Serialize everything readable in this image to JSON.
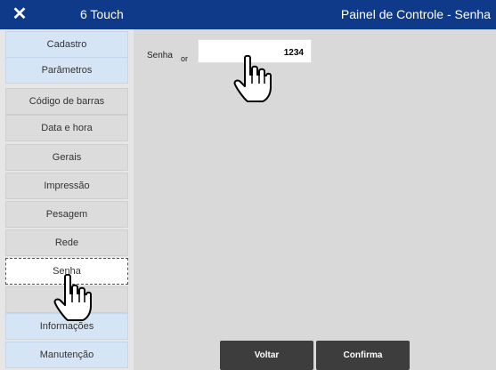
{
  "titlebar": {
    "app_name": "6 Touch",
    "context_title": "Painel de Controle - Senha",
    "close_glyph": "✕"
  },
  "sidebar": {
    "items": [
      {
        "label": "Cadastro"
      },
      {
        "label": "Parâmetros"
      },
      {
        "label": "Código de barras"
      },
      {
        "label": "Data e hora"
      },
      {
        "label": "Gerais"
      },
      {
        "label": "Impressão"
      },
      {
        "label": "Pesagem"
      },
      {
        "label": "Rede"
      },
      {
        "label": "Senha"
      },
      {
        "label": ""
      },
      {
        "label": "Informações"
      },
      {
        "label": "Manutenção"
      }
    ]
  },
  "form": {
    "label": "Senha",
    "label_fragment": "or",
    "value": "1234"
  },
  "buttons": {
    "back": "Voltar",
    "confirm": "Confirma"
  },
  "colors": {
    "titlebar": "#0f3a8a",
    "nav_blue": "#d6e5f5",
    "button": "#3d3d3d"
  }
}
